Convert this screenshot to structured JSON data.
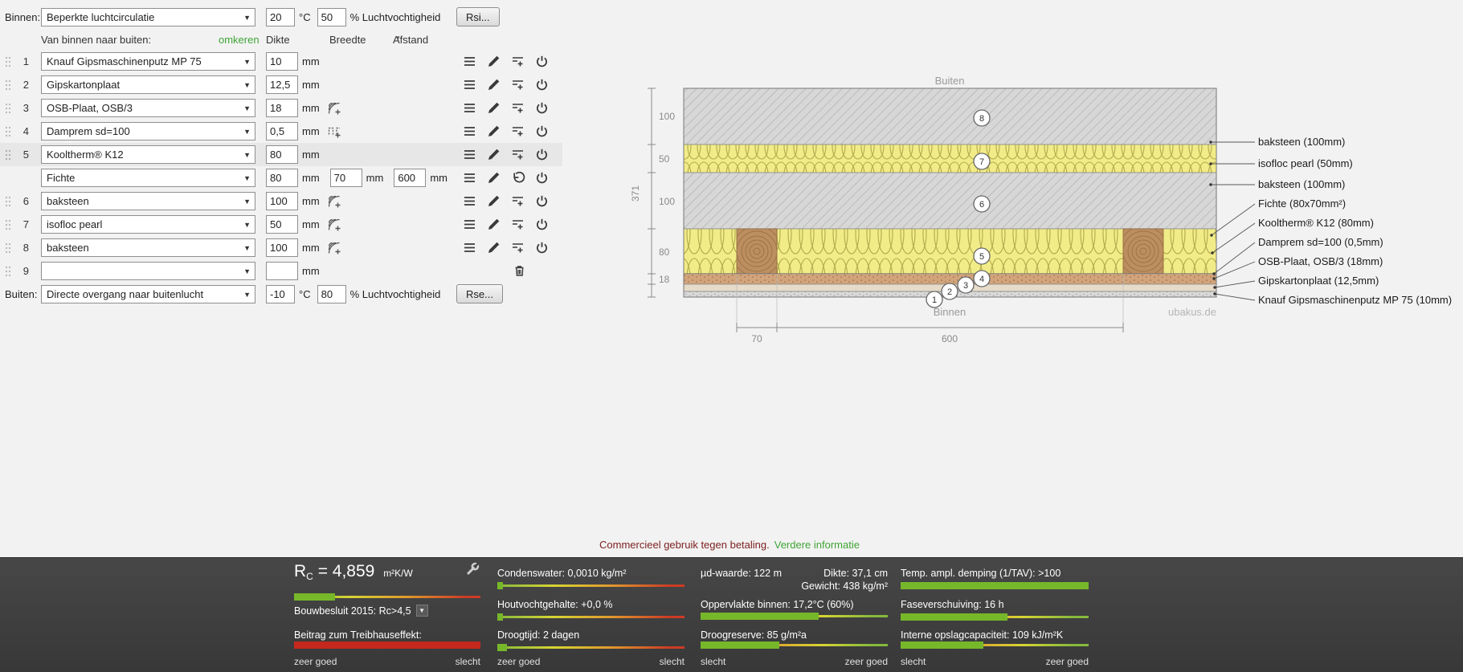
{
  "inside": {
    "label": "Binnen:",
    "surface": "Beperkte luchtcirculatie",
    "temp": "20",
    "temp_unit": "°C",
    "humidity": "50",
    "humidity_label": "% Luchtvochtigheid",
    "button": "Rsi..."
  },
  "outside": {
    "label": "Buiten:",
    "surface": "Directe overgang naar buitenlucht",
    "temp": "-10",
    "temp_unit": "°C",
    "humidity": "80",
    "humidity_label": "% Luchtvochtigheid",
    "button": "Rse..."
  },
  "header": {
    "direction": "Van binnen naar buiten:",
    "reverse": "omkeren",
    "dikte": "Dikte",
    "breedte": "Breedte",
    "afstand": "Afstand",
    "unit": "mm"
  },
  "layers": [
    {
      "num": "1",
      "material": "Knauf Gipsmaschinenputz MP 75",
      "thickness": "10"
    },
    {
      "num": "2",
      "material": "Gipskartonplaat",
      "thickness": "12,5"
    },
    {
      "num": "3",
      "material": "OSB-Plaat, OSB/3",
      "thickness": "18"
    },
    {
      "num": "4",
      "material": "Damprem sd=100",
      "thickness": "0,5"
    },
    {
      "num": "5",
      "material": "Kooltherm® K12",
      "thickness": "80"
    },
    {
      "num": "6",
      "material": "baksteen",
      "thickness": "100"
    },
    {
      "num": "7",
      "material": "isofloc pearl",
      "thickness": "50"
    },
    {
      "num": "8",
      "material": "baksteen",
      "thickness": "100"
    },
    {
      "num": "9",
      "material": "",
      "thickness": ""
    }
  ],
  "stud_row": {
    "material": "Fichte",
    "thickness": "80",
    "width": "70",
    "distance": "600"
  },
  "diagram": {
    "buiten": "Buiten",
    "binnen": "Binnen",
    "watermark": "ubakus.de",
    "total": "371",
    "dims_left": [
      "100",
      "50",
      "100",
      "80",
      "18"
    ],
    "dim_w_stud": "70",
    "dim_w_bay": "600",
    "markers": [
      "1",
      "2",
      "3",
      "4",
      "5",
      "6",
      "7",
      "8"
    ],
    "legend": [
      "baksteen (100mm)",
      "isofloc pearl (50mm)",
      "baksteen (100mm)",
      "Fichte (80x70mm²)",
      "Kooltherm® K12 (80mm)",
      "Damprem sd=100 (0,5mm)",
      "OSB-Plaat, OSB/3 (18mm)",
      "Gipskartonplaat (12,5mm)",
      "Knauf Gipsmaschinenputz MP 75 (10mm)"
    ]
  },
  "notice": {
    "text": "Commercieel gebruik tegen betaling.",
    "link": "Verdere informatie"
  },
  "results": {
    "rc_symbol": "R",
    "rc_sub": "C",
    "rc_value": "= 4,859",
    "rc_unit": "m²K/W",
    "rc_pct": 22,
    "bouwbesluit": "Bouwbesluit 2015: Rc>4,5",
    "treibhaus_label": "Beitrag zum Treibhauseffekt:",
    "treibhaus_pct": 100,
    "scale_good": "zeer goed",
    "scale_bad": "slecht",
    "condenswater": "Condenswater: 0,0010 kg/m²",
    "condenswater_pct": 3,
    "houtvocht": "Houtvochtgehalte: +0,0 %",
    "houtvocht_pct": 3,
    "droogtijd": "Droogtijd: 2 dagen",
    "droogtijd_pct": 5,
    "ud_waarde": "µd-waarde: 122 m",
    "dikte": "Dikte: 37,1 cm",
    "gewicht": "Gewicht: 438 kg/m²",
    "oppervlakte": "Oppervlakte binnen: 17,2°C (60%)",
    "oppervlakte_pct": 63,
    "droogreserve": "Droogreserve: 85 g/m²a",
    "droogreserve_pct": 42,
    "tav": "Temp. ampl. demping (1/TAV): >100",
    "tav_pct": 100,
    "fase": "Faseverschuiving: 16 h",
    "fase_pct": 57,
    "opslag": "Interne opslagcapaciteit: 109 kJ/m²K",
    "opslag_pct": 44
  },
  "colors": {
    "link_green": "#3fa535",
    "notice_red": "#7c1f1f",
    "bar_green": "#76b82a",
    "bar_red": "#c5281c",
    "insulation_yellow": "#f1ec87",
    "wood_brown": "#bd8f60"
  }
}
